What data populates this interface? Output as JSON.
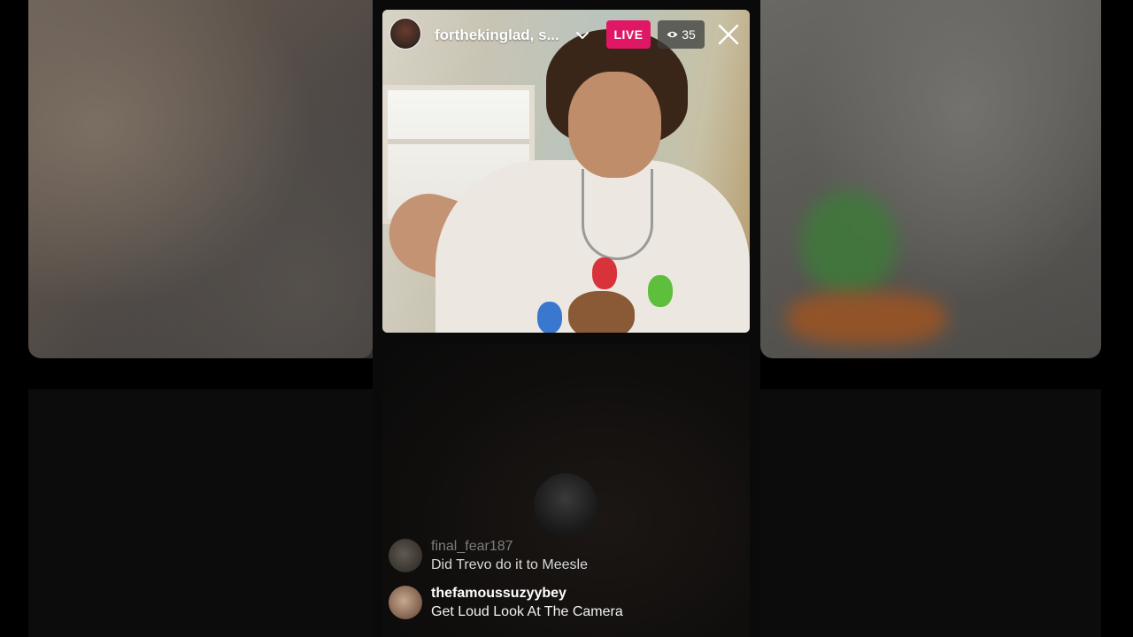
{
  "host": {
    "username": "forthekinglad, s...",
    "avatar_icon": "user-avatar"
  },
  "status": {
    "live_label": "LIVE",
    "live_color": "#df1764",
    "viewer_count": "35",
    "viewer_icon": "eye-icon"
  },
  "controls": {
    "dropdown_icon": "chevron-down-icon",
    "close_icon": "close-icon"
  },
  "guest": {
    "avatar_icon": "user-avatar"
  },
  "comments": [
    {
      "username": "final_fear187",
      "text": "Did Trevo do it to Meesle"
    },
    {
      "username": "thefamoussuzyybey",
      "text": "Get Loud Look At The Camera"
    }
  ]
}
